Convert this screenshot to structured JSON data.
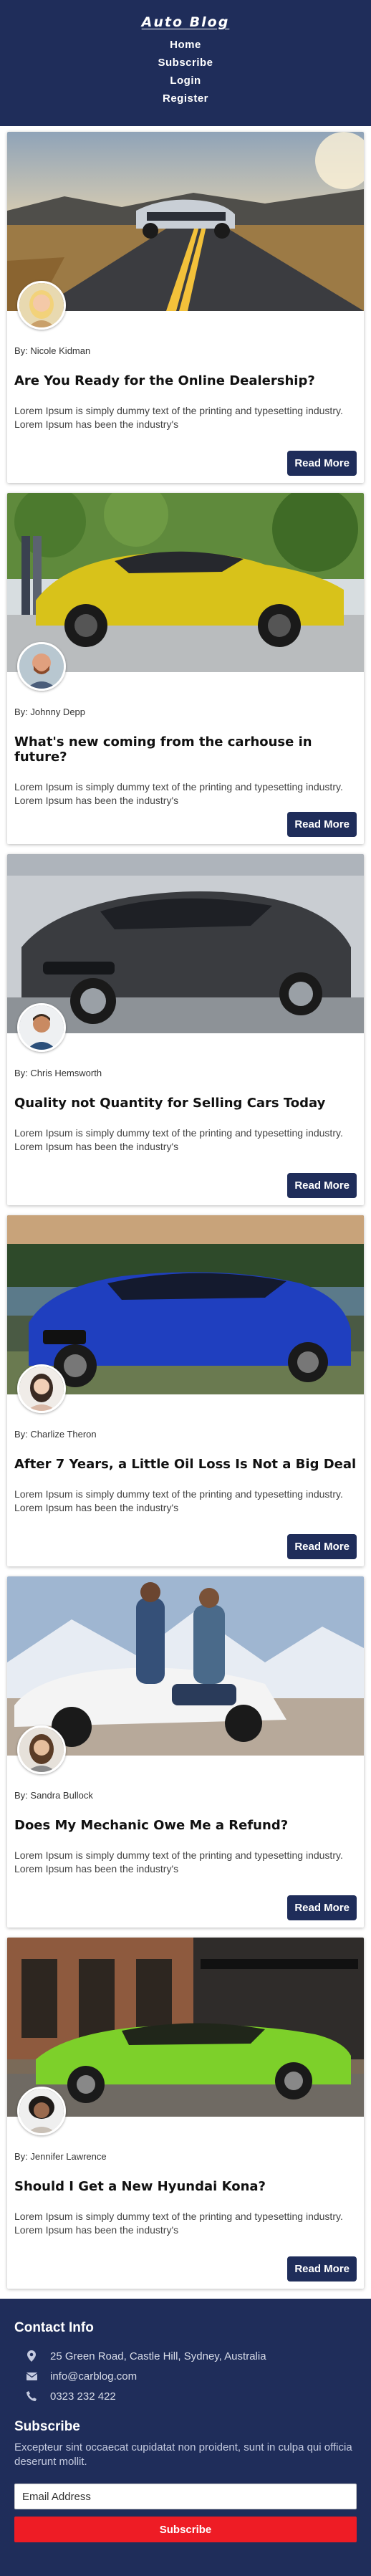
{
  "header": {
    "brand": "Auto Blog",
    "nav": [
      "Home",
      "Subscribe",
      "Login",
      "Register"
    ]
  },
  "posts": [
    {
      "author": "By: Nicole Kidman",
      "title": "Are You Ready for the Online Dealership?",
      "excerpt": "Lorem Ipsum is simply dummy text of the printing and typesetting industry. Lorem Ipsum has been the industry's",
      "button": "Read More"
    },
    {
      "author": "By: Johnny Depp",
      "title": "What's new coming from the carhouse in future?",
      "excerpt": "Lorem Ipsum is simply dummy text of the printing and typesetting industry. Lorem Ipsum has been the industry's",
      "button": "Read More"
    },
    {
      "author": "By: Chris Hemsworth",
      "title": "Quality not Quantity for Selling Cars Today",
      "excerpt": "Lorem Ipsum is simply dummy text of the printing and typesetting industry. Lorem Ipsum has been the industry's",
      "button": "Read More"
    },
    {
      "author": "By: Charlize Theron",
      "title": "After 7 Years, a Little Oil Loss Is Not a Big Deal",
      "excerpt": "Lorem Ipsum is simply dummy text of the printing and typesetting industry. Lorem Ipsum has been the industry's",
      "button": "Read More"
    },
    {
      "author": "By: Sandra Bullock",
      "title": "Does My Mechanic Owe Me a Refund?",
      "excerpt": "Lorem Ipsum is simply dummy text of the printing and typesetting industry. Lorem Ipsum has been the industry's",
      "button": "Read More"
    },
    {
      "author": "By: Jennifer Lawrence",
      "title": "Should I Get a New Hyundai Kona?",
      "excerpt": "Lorem Ipsum is simply dummy text of the printing and typesetting industry. Lorem Ipsum has been the industry's",
      "button": "Read More"
    }
  ],
  "footer": {
    "contact_heading": "Contact Info",
    "address": "25 Green Road, Castle Hill, Sydney, Australia",
    "email": "info@carblog.com",
    "phone": "0323 232 422",
    "subscribe_heading": "Subscribe",
    "subscribe_text": "Excepteur sint occaecat cupidatat non proident, sunt in culpa qui officia deserunt mollit.",
    "email_placeholder": "Email Address",
    "subscribe_button": "Subscribe"
  },
  "colors": {
    "header_bg": "#1f2d5a",
    "button_bg": "#1f2d5a",
    "subscribe_bg": "#ee1c25"
  }
}
